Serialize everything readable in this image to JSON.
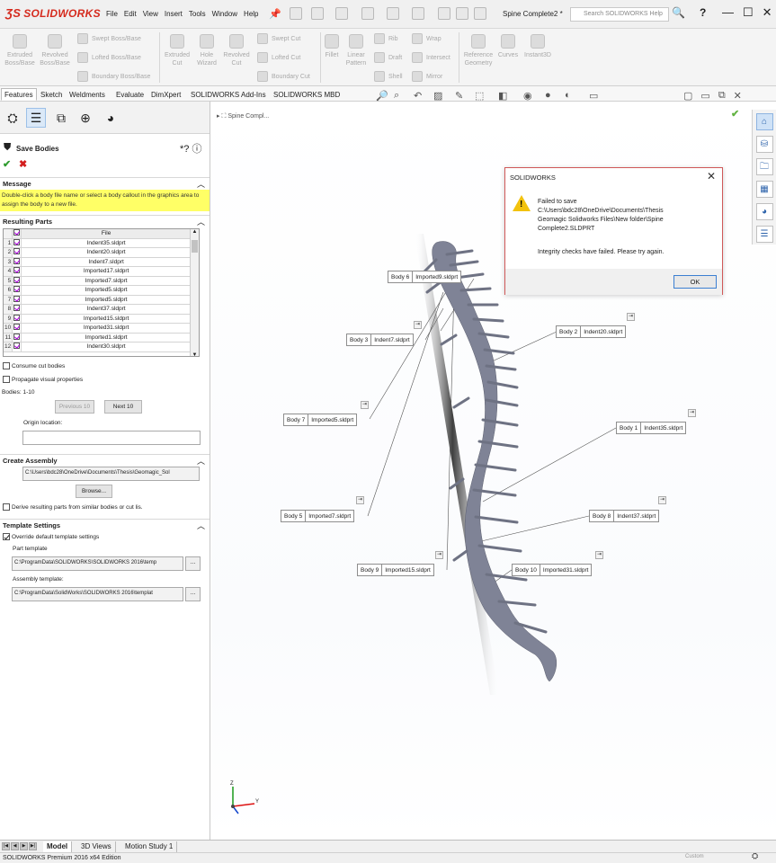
{
  "app": {
    "logo": "SOLIDWORKS",
    "menus": [
      "File",
      "Edit",
      "View",
      "Insert",
      "Tools",
      "Window",
      "Help"
    ],
    "doc_title": "Spine Complete2 *",
    "search_placeholder": "Search SOLIDWORKS Help",
    "help_label": "?"
  },
  "command_manager": {
    "features": {
      "extruded_boss": "Extruded Boss/Base",
      "revolved_boss": "Revolved Boss/Base",
      "swept_boss": "Swept Boss/Base",
      "lofted_boss": "Lofted Boss/Base",
      "boundary_boss": "Boundary Boss/Base",
      "extruded_cut": "Extruded Cut",
      "hole_wizard": "Hole Wizard",
      "revolved_cut": "Revolved Cut",
      "swept_cut": "Swept Cut",
      "lofted_cut": "Lofted Cut",
      "boundary_cut": "Boundary Cut",
      "fillet": "Fillet",
      "linear_pattern": "Linear Pattern",
      "rib": "Rib",
      "draft": "Draft",
      "shell": "Shell",
      "wrap": "Wrap",
      "intersect": "Intersect",
      "mirror": "Mirror",
      "reference_geometry": "Reference Geometry",
      "curves": "Curves",
      "instant3d": "Instant3D"
    }
  },
  "tabs": [
    "Features",
    "Sketch",
    "Weldments",
    "Evaluate",
    "DimXpert",
    "SOLIDWORKS Add-Ins",
    "SOLIDWORKS MBD"
  ],
  "property_manager": {
    "title": "Save Bodies",
    "message_header": "Message",
    "message_text": "Double-click a body file name or select a body callout in the graphics area to assign the body to a new file.",
    "resulting_parts_header": "Resulting Parts",
    "file_col": "File",
    "rows": [
      {
        "num": "1",
        "file": "Indent35.sldprt"
      },
      {
        "num": "2",
        "file": "Indent20.sldprt"
      },
      {
        "num": "3",
        "file": "Indent7.sldprt"
      },
      {
        "num": "4",
        "file": "Imported17.sldprt"
      },
      {
        "num": "5",
        "file": "Imported7.sldprt"
      },
      {
        "num": "6",
        "file": "Imported5.sldprt"
      },
      {
        "num": "7",
        "file": "Imported5.sldprt"
      },
      {
        "num": "8",
        "file": "Indent37.sldprt"
      },
      {
        "num": "9",
        "file": "Imported15.sldprt"
      },
      {
        "num": "10",
        "file": "Imported31.sldprt"
      },
      {
        "num": "11",
        "file": "Imported1.sldprt"
      },
      {
        "num": "12",
        "file": "Indent30.sldprt"
      }
    ],
    "consume_cut": "Consume cut bodies",
    "propagate": "Propagate visual properties",
    "bodies_count": "Bodies: 1-10",
    "previous_btn": "Previous 10",
    "next_btn": "Next 10",
    "origin_location": "Origin location:",
    "create_assembly_header": "Create Assembly",
    "assembly_path": "C:\\Users\\bdc28\\OneDrive\\Documents\\Thesis\\Geomagic_Sol",
    "browse_btn": "Browse...",
    "derive": "Derive resulting parts from similar bodies or cut lis.",
    "template_header": "Template Settings",
    "override": "Override default template settings",
    "part_template_label": "Part template",
    "part_template_path": "C:\\ProgramData\\SOLIDWORKS\\SOLIDWORKS 2016\\temp",
    "assembly_template_label": "Assembly template:",
    "assembly_template_path": "C:\\ProgramData\\SolidWorks\\SOLIDWORKS 2016\\templat",
    "ellipsis": "..."
  },
  "graphics": {
    "tree_root": "Spine Compl...",
    "callouts": [
      {
        "key": "Body 6",
        "val": "Imported9.sldprt"
      },
      {
        "key": "Body 3",
        "val": "Indent7.sldprt"
      },
      {
        "key": "Body 2",
        "val": "Indent20.sldprt"
      },
      {
        "key": "Body 7",
        "val": "Imported5.sldprt"
      },
      {
        "key": "Body 1",
        "val": "Indent35.sldprt"
      },
      {
        "key": "Body 5",
        "val": "Imported7.sldprt"
      },
      {
        "key": "Body 8",
        "val": "Indent37.sldprt"
      },
      {
        "key": "Body 9",
        "val": "Imported15.sldprt"
      },
      {
        "key": "Body 10",
        "val": "Imported31.sldprt"
      }
    ],
    "triad_y": "Y",
    "triad_z": "Z"
  },
  "dialog": {
    "title": "SOLIDWORKS",
    "message": "Failed to save\nC:\\Users\\bdc28\\OneDrive\\Documents\\Thesis\nGeomagic Solidworks Files\\New folder\\Spine\nComplete2.SLDPRT",
    "detail": "Integrity checks have failed. Please try again.",
    "ok": "OK"
  },
  "bottom": {
    "tabs": [
      "Model",
      "3D Views",
      "Motion Study 1"
    ],
    "status": "SOLIDWORKS Premium 2016 x64 Edition",
    "status_right": "Custom"
  },
  "colors": {
    "brand_red": "#d52b1e",
    "message_yellow": "#ffff66",
    "dialog_border": "#d05858",
    "warning_yellow": "#f2c20d",
    "spine_gray": "#7f8396"
  }
}
